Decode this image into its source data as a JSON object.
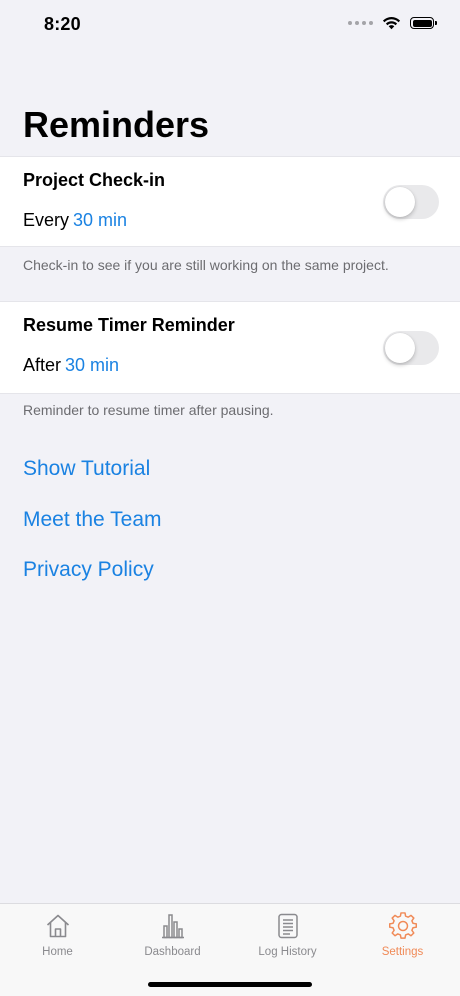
{
  "status_bar": {
    "time": "8:20",
    "icons": [
      "signal-dots-icon",
      "wifi-icon",
      "battery-icon"
    ]
  },
  "page": {
    "title": "Reminders"
  },
  "reminders": [
    {
      "title": "Project Check-in",
      "prefix": "Every",
      "interval": "30 min",
      "enabled": false,
      "footnote": "Check-in to see if you are still working on the same project."
    },
    {
      "title": "Resume Timer Reminder",
      "prefix": "After",
      "interval": "30 min",
      "enabled": false,
      "footnote": "Reminder to resume timer after pausing."
    }
  ],
  "links": [
    {
      "label": "Show Tutorial"
    },
    {
      "label": "Meet the Team"
    },
    {
      "label": "Privacy Policy"
    }
  ],
  "tab_bar": {
    "active": "Settings",
    "tabs": [
      {
        "label": "Home",
        "icon": "home-icon"
      },
      {
        "label": "Dashboard",
        "icon": "bar-chart-icon"
      },
      {
        "label": "Log History",
        "icon": "document-icon"
      },
      {
        "label": "Settings",
        "icon": "gear-icon"
      }
    ]
  },
  "colors": {
    "accent_link": "#1a82e2",
    "active_tab": "#f08a57",
    "background": "#f2f2f7"
  }
}
